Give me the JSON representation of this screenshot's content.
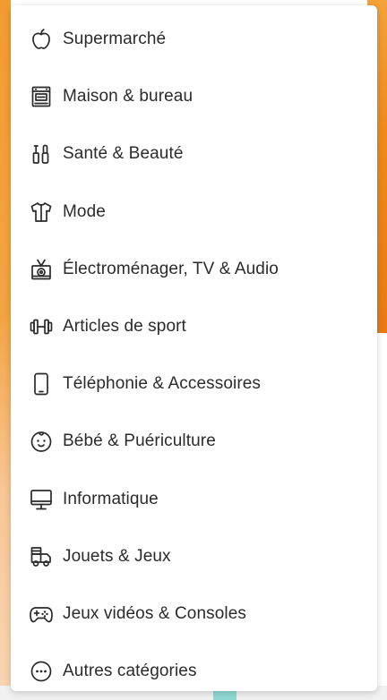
{
  "menu": {
    "items": [
      {
        "label": "Supermarché",
        "icon": "apple-icon"
      },
      {
        "label": "Maison & bureau",
        "icon": "appliance-icon"
      },
      {
        "label": "Santé & Beauté",
        "icon": "beauty-products-icon"
      },
      {
        "label": "Mode",
        "icon": "tshirt-icon"
      },
      {
        "label": "Électroménager, TV & Audio",
        "icon": "tv-icon"
      },
      {
        "label": "Articles de sport",
        "icon": "dumbbell-icon"
      },
      {
        "label": "Téléphonie & Accessoires",
        "icon": "phone-icon"
      },
      {
        "label": "Bébé & Puériculture",
        "icon": "baby-face-icon"
      },
      {
        "label": "Informatique",
        "icon": "monitor-icon"
      },
      {
        "label": "Jouets & Jeux",
        "icon": "toy-truck-icon"
      },
      {
        "label": "Jeux vidéos & Consoles",
        "icon": "gamepad-icon"
      },
      {
        "label": "Autres catégories",
        "icon": "more-icon"
      }
    ]
  },
  "colors": {
    "accent": "#f68b1e",
    "text": "#2b2b2b"
  }
}
